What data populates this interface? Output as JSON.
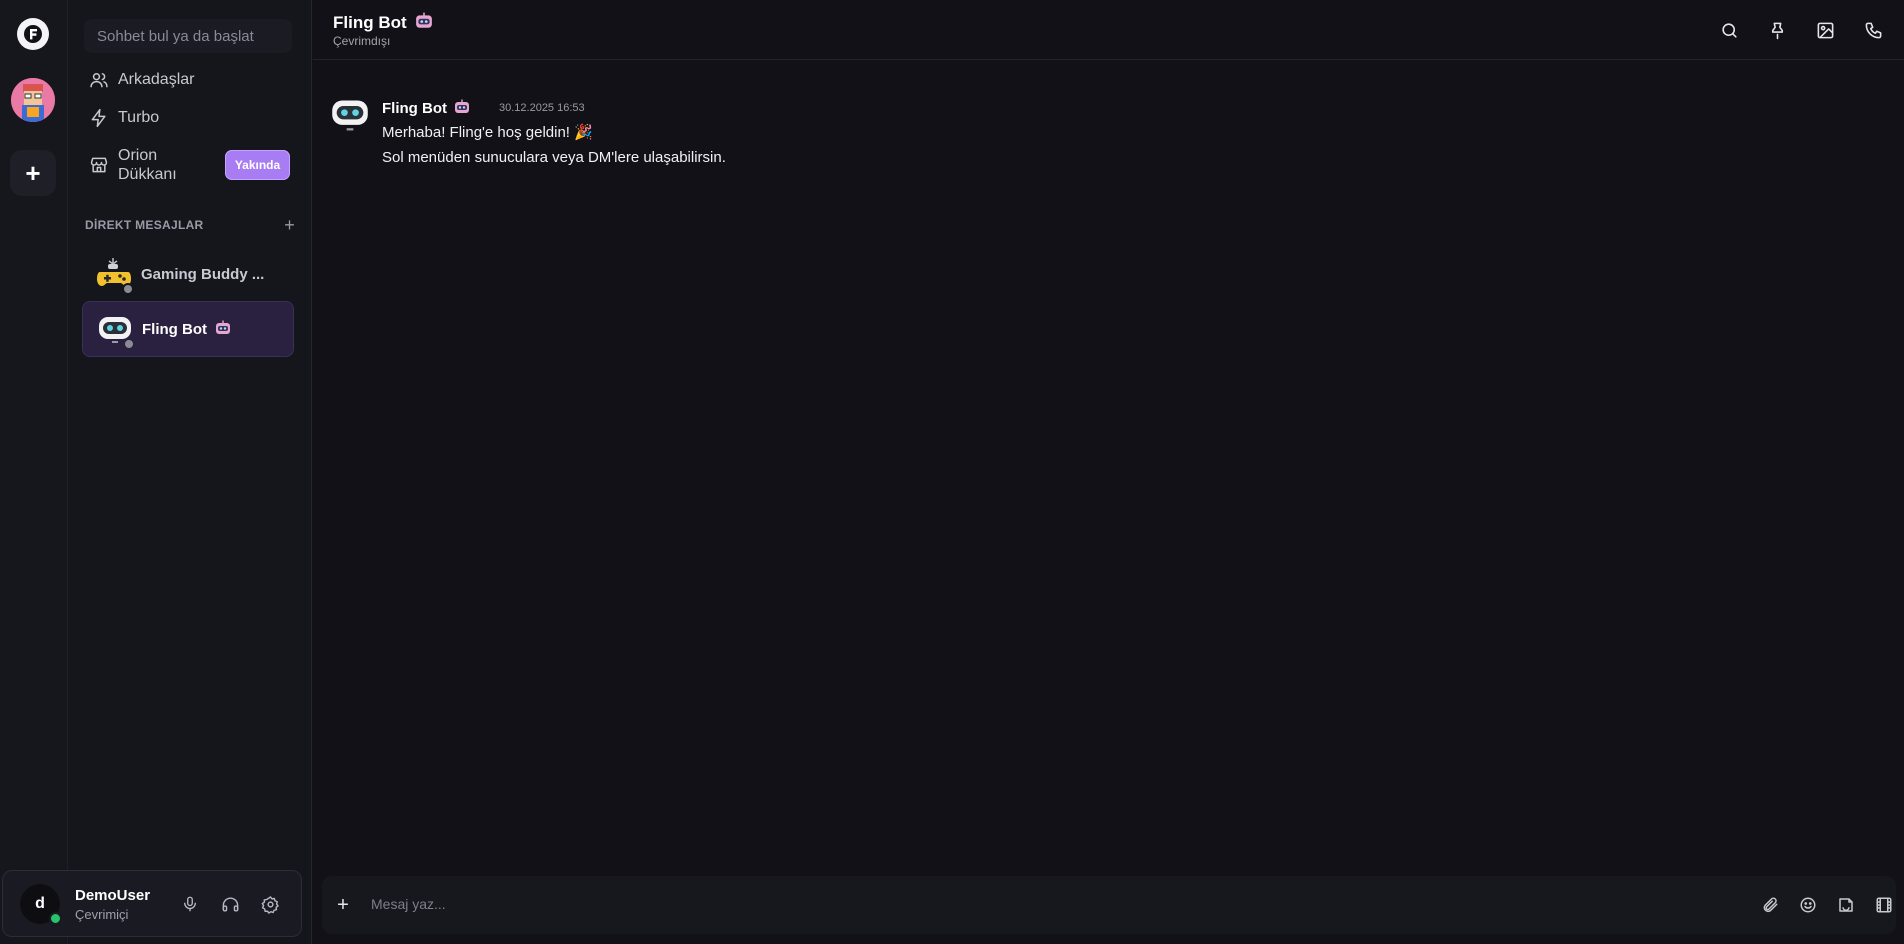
{
  "rail": {
    "logo_icon": "fling-logo-icon",
    "add_server_label": "+"
  },
  "sidebar": {
    "search_placeholder": "Sohbet bul ya da başlat",
    "nav": [
      {
        "label": "Arkadaşlar",
        "icon": "users-icon"
      },
      {
        "label": "Turbo",
        "icon": "lightning-icon"
      },
      {
        "label": "Orion Dükkanı",
        "icon": "store-icon",
        "badge": "Yakında"
      }
    ],
    "dm_header": "DİREKT MESAJLAR",
    "dm_add": "+",
    "dms": [
      {
        "name": "Gaming Buddy ...",
        "status": "offline",
        "active": false
      },
      {
        "name": "Fling Bot",
        "status": "offline",
        "active": true
      }
    ]
  },
  "user": {
    "avatar_letter": "d",
    "name": "DemoUser",
    "status": "Çevrimiçi",
    "status_color": "#27c46a"
  },
  "chat": {
    "title": "Fling Bot",
    "status": "Çevrimdışı",
    "messages": [
      {
        "author": "Fling Bot",
        "time": "30.12.2025 16:53",
        "lines": [
          "Merhaba! Fling'e hoş geldin! 🎉",
          "Sol menüden sunuculara veya DM'lere ulaşabilirsin."
        ]
      }
    ],
    "composer_placeholder": "Mesaj yaz...",
    "composer_plus": "+"
  },
  "colors": {
    "accent": "#a87cf2",
    "active_dm_bg": "#2a2140",
    "background": "#111117"
  }
}
